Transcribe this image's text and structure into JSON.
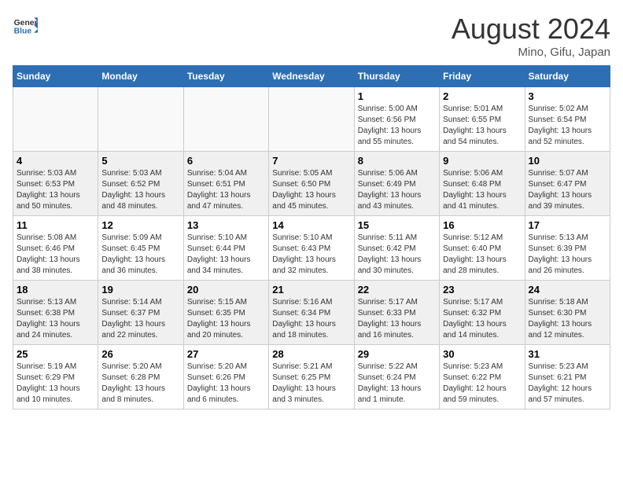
{
  "header": {
    "logo_general": "General",
    "logo_blue": "Blue",
    "main_title": "August 2024",
    "sub_title": "Mino, Gifu, Japan"
  },
  "days_of_week": [
    "Sunday",
    "Monday",
    "Tuesday",
    "Wednesday",
    "Thursday",
    "Friday",
    "Saturday"
  ],
  "weeks": [
    [
      {
        "day": "",
        "info": ""
      },
      {
        "day": "",
        "info": ""
      },
      {
        "day": "",
        "info": ""
      },
      {
        "day": "",
        "info": ""
      },
      {
        "day": "1",
        "info": "Sunrise: 5:00 AM\nSunset: 6:56 PM\nDaylight: 13 hours\nand 55 minutes."
      },
      {
        "day": "2",
        "info": "Sunrise: 5:01 AM\nSunset: 6:55 PM\nDaylight: 13 hours\nand 54 minutes."
      },
      {
        "day": "3",
        "info": "Sunrise: 5:02 AM\nSunset: 6:54 PM\nDaylight: 13 hours\nand 52 minutes."
      }
    ],
    [
      {
        "day": "4",
        "info": "Sunrise: 5:03 AM\nSunset: 6:53 PM\nDaylight: 13 hours\nand 50 minutes."
      },
      {
        "day": "5",
        "info": "Sunrise: 5:03 AM\nSunset: 6:52 PM\nDaylight: 13 hours\nand 48 minutes."
      },
      {
        "day": "6",
        "info": "Sunrise: 5:04 AM\nSunset: 6:51 PM\nDaylight: 13 hours\nand 47 minutes."
      },
      {
        "day": "7",
        "info": "Sunrise: 5:05 AM\nSunset: 6:50 PM\nDaylight: 13 hours\nand 45 minutes."
      },
      {
        "day": "8",
        "info": "Sunrise: 5:06 AM\nSunset: 6:49 PM\nDaylight: 13 hours\nand 43 minutes."
      },
      {
        "day": "9",
        "info": "Sunrise: 5:06 AM\nSunset: 6:48 PM\nDaylight: 13 hours\nand 41 minutes."
      },
      {
        "day": "10",
        "info": "Sunrise: 5:07 AM\nSunset: 6:47 PM\nDaylight: 13 hours\nand 39 minutes."
      }
    ],
    [
      {
        "day": "11",
        "info": "Sunrise: 5:08 AM\nSunset: 6:46 PM\nDaylight: 13 hours\nand 38 minutes."
      },
      {
        "day": "12",
        "info": "Sunrise: 5:09 AM\nSunset: 6:45 PM\nDaylight: 13 hours\nand 36 minutes."
      },
      {
        "day": "13",
        "info": "Sunrise: 5:10 AM\nSunset: 6:44 PM\nDaylight: 13 hours\nand 34 minutes."
      },
      {
        "day": "14",
        "info": "Sunrise: 5:10 AM\nSunset: 6:43 PM\nDaylight: 13 hours\nand 32 minutes."
      },
      {
        "day": "15",
        "info": "Sunrise: 5:11 AM\nSunset: 6:42 PM\nDaylight: 13 hours\nand 30 minutes."
      },
      {
        "day": "16",
        "info": "Sunrise: 5:12 AM\nSunset: 6:40 PM\nDaylight: 13 hours\nand 28 minutes."
      },
      {
        "day": "17",
        "info": "Sunrise: 5:13 AM\nSunset: 6:39 PM\nDaylight: 13 hours\nand 26 minutes."
      }
    ],
    [
      {
        "day": "18",
        "info": "Sunrise: 5:13 AM\nSunset: 6:38 PM\nDaylight: 13 hours\nand 24 minutes."
      },
      {
        "day": "19",
        "info": "Sunrise: 5:14 AM\nSunset: 6:37 PM\nDaylight: 13 hours\nand 22 minutes."
      },
      {
        "day": "20",
        "info": "Sunrise: 5:15 AM\nSunset: 6:35 PM\nDaylight: 13 hours\nand 20 minutes."
      },
      {
        "day": "21",
        "info": "Sunrise: 5:16 AM\nSunset: 6:34 PM\nDaylight: 13 hours\nand 18 minutes."
      },
      {
        "day": "22",
        "info": "Sunrise: 5:17 AM\nSunset: 6:33 PM\nDaylight: 13 hours\nand 16 minutes."
      },
      {
        "day": "23",
        "info": "Sunrise: 5:17 AM\nSunset: 6:32 PM\nDaylight: 13 hours\nand 14 minutes."
      },
      {
        "day": "24",
        "info": "Sunrise: 5:18 AM\nSunset: 6:30 PM\nDaylight: 13 hours\nand 12 minutes."
      }
    ],
    [
      {
        "day": "25",
        "info": "Sunrise: 5:19 AM\nSunset: 6:29 PM\nDaylight: 13 hours\nand 10 minutes."
      },
      {
        "day": "26",
        "info": "Sunrise: 5:20 AM\nSunset: 6:28 PM\nDaylight: 13 hours\nand 8 minutes."
      },
      {
        "day": "27",
        "info": "Sunrise: 5:20 AM\nSunset: 6:26 PM\nDaylight: 13 hours\nand 6 minutes."
      },
      {
        "day": "28",
        "info": "Sunrise: 5:21 AM\nSunset: 6:25 PM\nDaylight: 13 hours\nand 3 minutes."
      },
      {
        "day": "29",
        "info": "Sunrise: 5:22 AM\nSunset: 6:24 PM\nDaylight: 13 hours\nand 1 minute."
      },
      {
        "day": "30",
        "info": "Sunrise: 5:23 AM\nSunset: 6:22 PM\nDaylight: 12 hours\nand 59 minutes."
      },
      {
        "day": "31",
        "info": "Sunrise: 5:23 AM\nSunset: 6:21 PM\nDaylight: 12 hours\nand 57 minutes."
      }
    ]
  ]
}
